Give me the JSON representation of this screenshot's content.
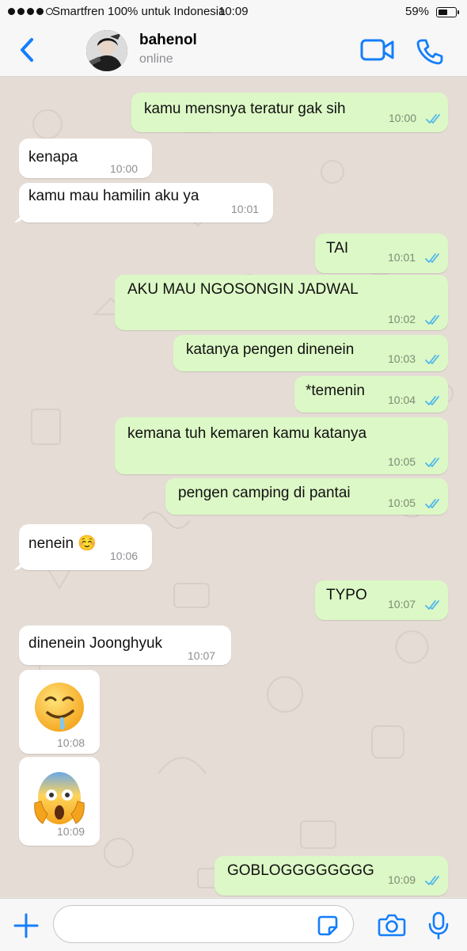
{
  "status_bar": {
    "carrier": "Smartfren 100% untuk Indonesia",
    "clock": "10:09",
    "battery_percent": "59%",
    "battery_level": 0.59,
    "signal_bars": 4
  },
  "header": {
    "back_icon": "chevron-left-icon",
    "contact_name": "bahenol",
    "contact_status": "online",
    "video_call_icon": "video-camera-icon",
    "voice_call_icon": "phone-icon"
  },
  "colors": {
    "accent": "#147efb",
    "outgoing_bubble": "#dcf8c6",
    "incoming_bubble": "#ffffff",
    "chat_background": "#e5ddd5",
    "read_ticks": "#4fb6ec"
  },
  "messages": [
    {
      "direction": "out",
      "text": "kamu mensnya teratur gak sih",
      "time": "10:00",
      "read": true
    },
    {
      "direction": "in",
      "text": "kenapa",
      "time": "10:00"
    },
    {
      "direction": "in",
      "text": "kamu mau hamilin aku ya",
      "time": "10:01"
    },
    {
      "direction": "out",
      "text": "TAI",
      "time": "10:01",
      "read": true
    },
    {
      "direction": "out",
      "text": "AKU MAU NGOSONGIN JADWAL",
      "time": "10:02",
      "read": true
    },
    {
      "direction": "out",
      "text": "katanya pengen dinenein",
      "time": "10:03",
      "read": true
    },
    {
      "direction": "out",
      "text": "*temenin",
      "time": "10:04",
      "read": true
    },
    {
      "direction": "out",
      "text": "kemana tuh kemaren kamu katanya",
      "time": "10:05",
      "read": true
    },
    {
      "direction": "out",
      "text": "pengen camping di pantai",
      "time": "10:05",
      "read": true
    },
    {
      "direction": "in",
      "text": "nenein ☺️",
      "time": "10:06"
    },
    {
      "direction": "out",
      "text": "TYPO",
      "time": "10:07",
      "read": true
    },
    {
      "direction": "in",
      "text": "dinenein Joonghyuk",
      "time": "10:07"
    },
    {
      "direction": "in",
      "emoji": "drooling-face-emoji",
      "time": "10:08"
    },
    {
      "direction": "in",
      "emoji": "screaming-in-fear-emoji",
      "time": "10:09"
    },
    {
      "direction": "out",
      "text": "GOBLOGGGGGGGG",
      "time": "10:09",
      "read": true
    }
  ],
  "input_bar": {
    "attach_icon": "plus-icon",
    "message_value": "",
    "sticker_icon": "sticker-icon",
    "camera_icon": "camera-icon",
    "mic_icon": "microphone-icon"
  }
}
